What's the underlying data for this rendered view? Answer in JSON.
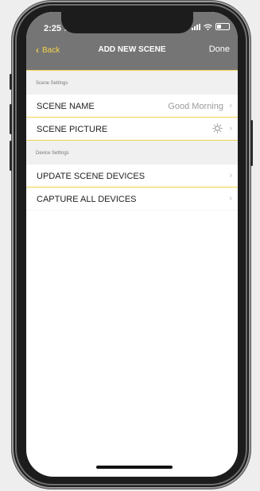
{
  "status_bar": {
    "time": "2:25"
  },
  "nav": {
    "back_label": "Back",
    "title": "ADD NEW SCENE",
    "done_label": "Done"
  },
  "sections": {
    "scene_settings": {
      "header": "Scene Settings",
      "scene_name_label": "SCENE NAME",
      "scene_name_value": "Good Morning",
      "scene_picture_label": "SCENE PICTURE",
      "scene_picture_icon": "sun-icon"
    },
    "device_settings": {
      "header": "Device Settings",
      "update_label": "UPDATE SCENE DEVICES",
      "capture_label": "CAPTURE ALL DEVICES"
    }
  },
  "colors": {
    "header_bg": "#757575",
    "accent": "#f6d24b",
    "divider": "#f2d24a"
  }
}
